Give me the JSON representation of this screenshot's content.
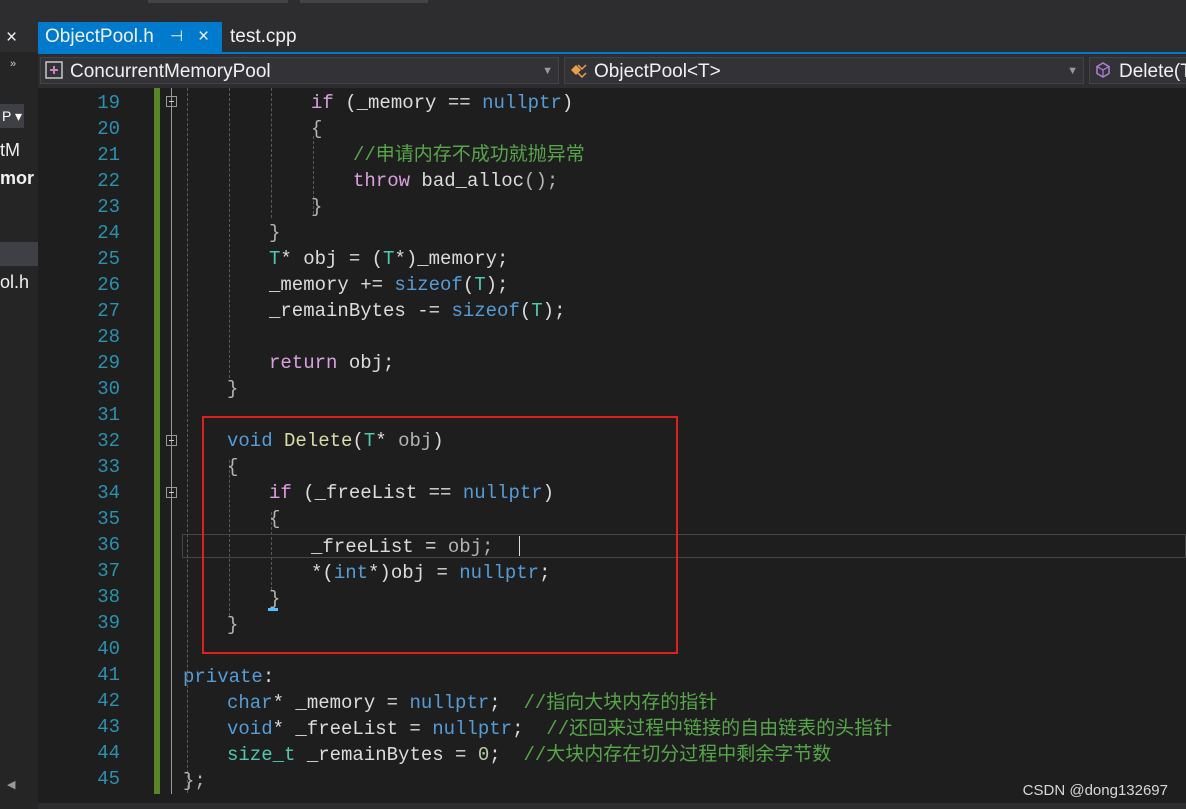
{
  "sidebar": {
    "close": "×",
    "chevrons": "»",
    "item_p": "P ▾",
    "text1": "tM",
    "text2": "mor",
    "text3": "ol.h"
  },
  "tabs": [
    {
      "label": "ObjectPool.h",
      "pin": "⊣",
      "close": "×"
    },
    {
      "label": "test.cpp"
    }
  ],
  "navbar": {
    "project": "ConcurrentMemoryPool",
    "scope": "ObjectPool<T>",
    "member": "Delete(T"
  },
  "editor": {
    "line_numbers": [
      "19",
      "20",
      "21",
      "22",
      "23",
      "24",
      "25",
      "26",
      "27",
      "28",
      "29",
      "30",
      "31",
      "32",
      "33",
      "34",
      "35",
      "36",
      "37",
      "38",
      "39",
      "40",
      "41",
      "42",
      "43",
      "44",
      "45"
    ]
  },
  "code": {
    "l19": {
      "kw": "if",
      "a": " (_memory ",
      "op": "==",
      "b": " ",
      "c": "nullptr",
      "d": ")"
    },
    "l20": "{",
    "l21": "//申请内存不成功就抛异常",
    "l22": {
      "kw": "throw",
      "a": " bad_alloc",
      "b": "();"
    },
    "l23": "}",
    "l24": "}",
    "l25": {
      "ty": "T",
      "a": "* obj = (",
      "ty2": "T",
      "b": "*)_memory;"
    },
    "l26": {
      "a": "_memory += ",
      "kw": "sizeof",
      "b": "(",
      "ty": "T",
      "c": ");"
    },
    "l27": {
      "a": "_remainBytes -= ",
      "kw": "sizeof",
      "b": "(",
      "ty": "T",
      "c": ");"
    },
    "l29": {
      "kw": "return",
      "a": " obj;"
    },
    "l30": "}",
    "l32": {
      "kw": "void",
      "fn": " Delete",
      "a": "(",
      "ty": "T",
      "b": "* ",
      "par": "obj",
      "c": ")"
    },
    "l33": "{",
    "l34": {
      "kw": "if",
      "a": " (_freeList == ",
      "c": "nullptr",
      "d": ")"
    },
    "l35": "{",
    "l36": {
      "a": "_freeList = ",
      "par": "obj",
      "b": ";"
    },
    "l37": {
      "a": "*(",
      "kw": "int",
      "b": "*)obj = ",
      "c": "nullptr",
      "d": ";"
    },
    "l38": "}",
    "l39": "}",
    "l41": {
      "kw": "private",
      "a": ":"
    },
    "l42": {
      "kw": "char",
      "a": "* _memory = ",
      "c": "nullptr",
      "b": ";  ",
      "cm": "//指向大块内存的指针"
    },
    "l43": {
      "kw": "void",
      "a": "* _freeList = ",
      "c": "nullptr",
      "b": ";  ",
      "cm": "//还回来过程中链接的自由链表的头指针"
    },
    "l44": {
      "ty": "size_t",
      "a": " _remainBytes = ",
      "num": "0",
      "b": ";  ",
      "cm": "//大块内存在切分过程中剩余字节数"
    },
    "l45": "};"
  },
  "watermark": "CSDN @dong132697"
}
